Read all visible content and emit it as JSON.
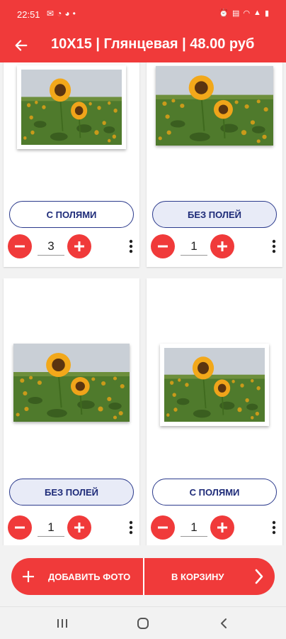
{
  "status_bar": {
    "time": "22:51",
    "left_icons": [
      "mail-icon",
      "whatsapp-icon",
      "viber-icon",
      "dot-icon"
    ],
    "right_icons": [
      "alarm-icon",
      "volte-icon",
      "wifi-icon",
      "signal-icon",
      "battery-icon"
    ]
  },
  "app_bar": {
    "title": "10X15 | Глянцевая | 48.00 руб",
    "back_icon": "arrow-left-icon"
  },
  "photos": [
    {
      "mode": "С ПОЛЯМИ",
      "quantity": "3",
      "mode_style": "outline",
      "photo_style": "bordered"
    },
    {
      "mode": "БЕЗ ПОЛЕЙ",
      "quantity": "1",
      "mode_style": "filled",
      "photo_style": "full"
    },
    {
      "mode": "БЕЗ ПОЛЕЙ",
      "quantity": "1",
      "mode_style": "filled",
      "photo_style": "full"
    },
    {
      "mode": "С ПОЛЯМИ",
      "quantity": "1",
      "mode_style": "outline",
      "photo_style": "bordered"
    }
  ],
  "bottom_actions": {
    "add_photo": "ДОБАВИТЬ ФОТО",
    "to_cart": "В КОРЗИНУ"
  },
  "colors": {
    "primary": "#f03a3a",
    "button_text": "#1d2a78",
    "filled_button_bg": "#e8ebf7"
  }
}
